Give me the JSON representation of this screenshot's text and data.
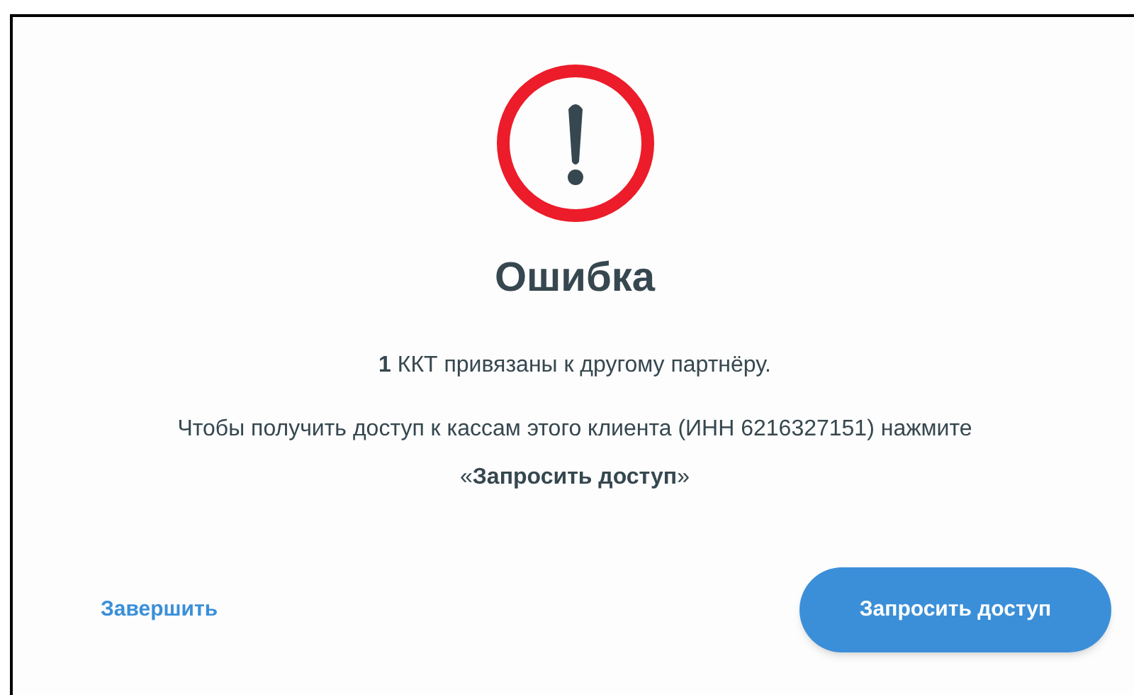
{
  "dialog": {
    "title": "Ошибка",
    "message": "**1** ККТ привязаны к другому партнёру.",
    "instruction": "Чтобы получить доступ к кассам этого клиента (ИНН 6216327151) нажмите «**Запросить доступ**»",
    "secondary_action": "Завершить",
    "primary_action": "Запросить доступ"
  }
}
